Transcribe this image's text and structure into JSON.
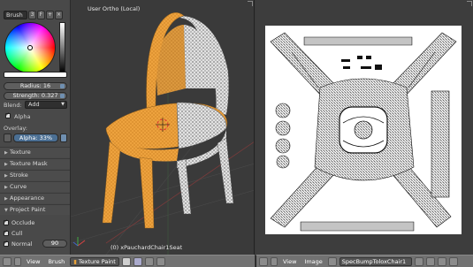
{
  "tool_panel": {
    "brush": {
      "label": "Brush",
      "users": "3",
      "fake": "F"
    },
    "color": {
      "wheel_hex": "#ffffff",
      "swatch_hex": "#ffffff"
    },
    "radius_label": "Radius: 16",
    "strength_label": "Strength: 0.327",
    "blend": {
      "label": "Blend:",
      "value": "Add"
    },
    "alpha_checkbox": "Alpha",
    "overlay_label": "Overlay:",
    "alpha_overlay": "Alpha: 33%",
    "sections": [
      "Texture",
      "Texture Mask",
      "Stroke",
      "Curve",
      "Appearance",
      "Project Paint"
    ],
    "project_paint": {
      "occlude": "Occlude",
      "cull": "Cull",
      "normal": "Normal",
      "normal_value": "90"
    }
  },
  "viewport": {
    "label": "User Ortho (Local)",
    "object_label": "(0) xPauchardChair1Seat",
    "paint_color": "#e8a23a"
  },
  "header_3d": {
    "items": [
      "View",
      "Brush"
    ],
    "mode": "Texture Paint"
  },
  "header_uv": {
    "items": [
      "View",
      "Image"
    ],
    "image_name": "SpecBumpToloxChair1"
  }
}
